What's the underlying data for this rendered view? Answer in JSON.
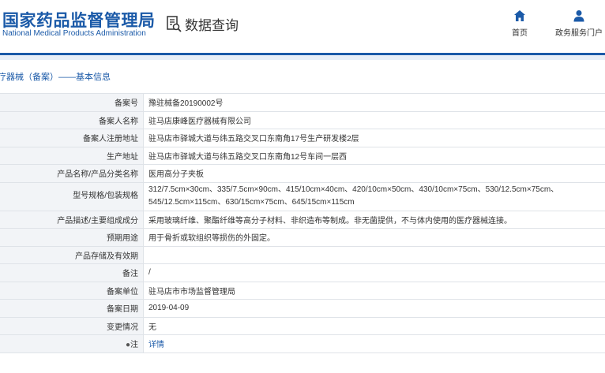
{
  "header": {
    "logo_cn": "国家药品监督管理局",
    "logo_en": "National Medical Products Administration",
    "query_label": "数据查询",
    "nav": [
      {
        "label": "首页",
        "icon": "home-icon"
      },
      {
        "label": "政务服务门户",
        "icon": "user-icon"
      }
    ]
  },
  "colors": {
    "brand_blue": "#1b5aa8",
    "label_bg": "#f2f4f7",
    "border": "#dfe3e8"
  },
  "section_title": "医疗器械（备案）——基本信息",
  "rows": [
    {
      "label": "备案号",
      "value": "豫驻械备20190002号"
    },
    {
      "label": "备案人名称",
      "value": "驻马店康峰医疗器械有限公司"
    },
    {
      "label": "备案人注册地址",
      "value": "驻马店市驿城大道与纬五路交叉口东南角17号生产研发楼2层"
    },
    {
      "label": "生产地址",
      "value": "驻马店市驿城大道与纬五路交叉口东南角12号车间一层西"
    },
    {
      "label": "产品名称/产品分类名称",
      "value": "医用高分子夹板"
    },
    {
      "label": "型号规格/包装规格",
      "value": "312/7.5cm×30cm、335/7.5cm×90cm、415/10cm×40cm、420/10cm×50cm、430/10cm×75cm、530/12.5cm×75cm、545/12.5cm×115cm、630/15cm×75cm、645/15cm×115cm"
    },
    {
      "label": "产品描述/主要组成成分",
      "value": "采用玻璃纤维、聚酯纤维等高分子材料、非织造布等制成。非无菌提供，不与体内使用的医疗器械连接。"
    },
    {
      "label": "预期用途",
      "value": "用于骨折或软组织等损伤的外固定。"
    },
    {
      "label": "产品存储及有效期",
      "value": ""
    },
    {
      "label": "备注",
      "value": "/"
    },
    {
      "label": "备案单位",
      "value": "驻马店市市场监督管理局"
    },
    {
      "label": "备案日期",
      "value": "2019-04-09"
    },
    {
      "label": "变更情况",
      "value": "无"
    },
    {
      "label": "注",
      "value": "详情"
    }
  ]
}
